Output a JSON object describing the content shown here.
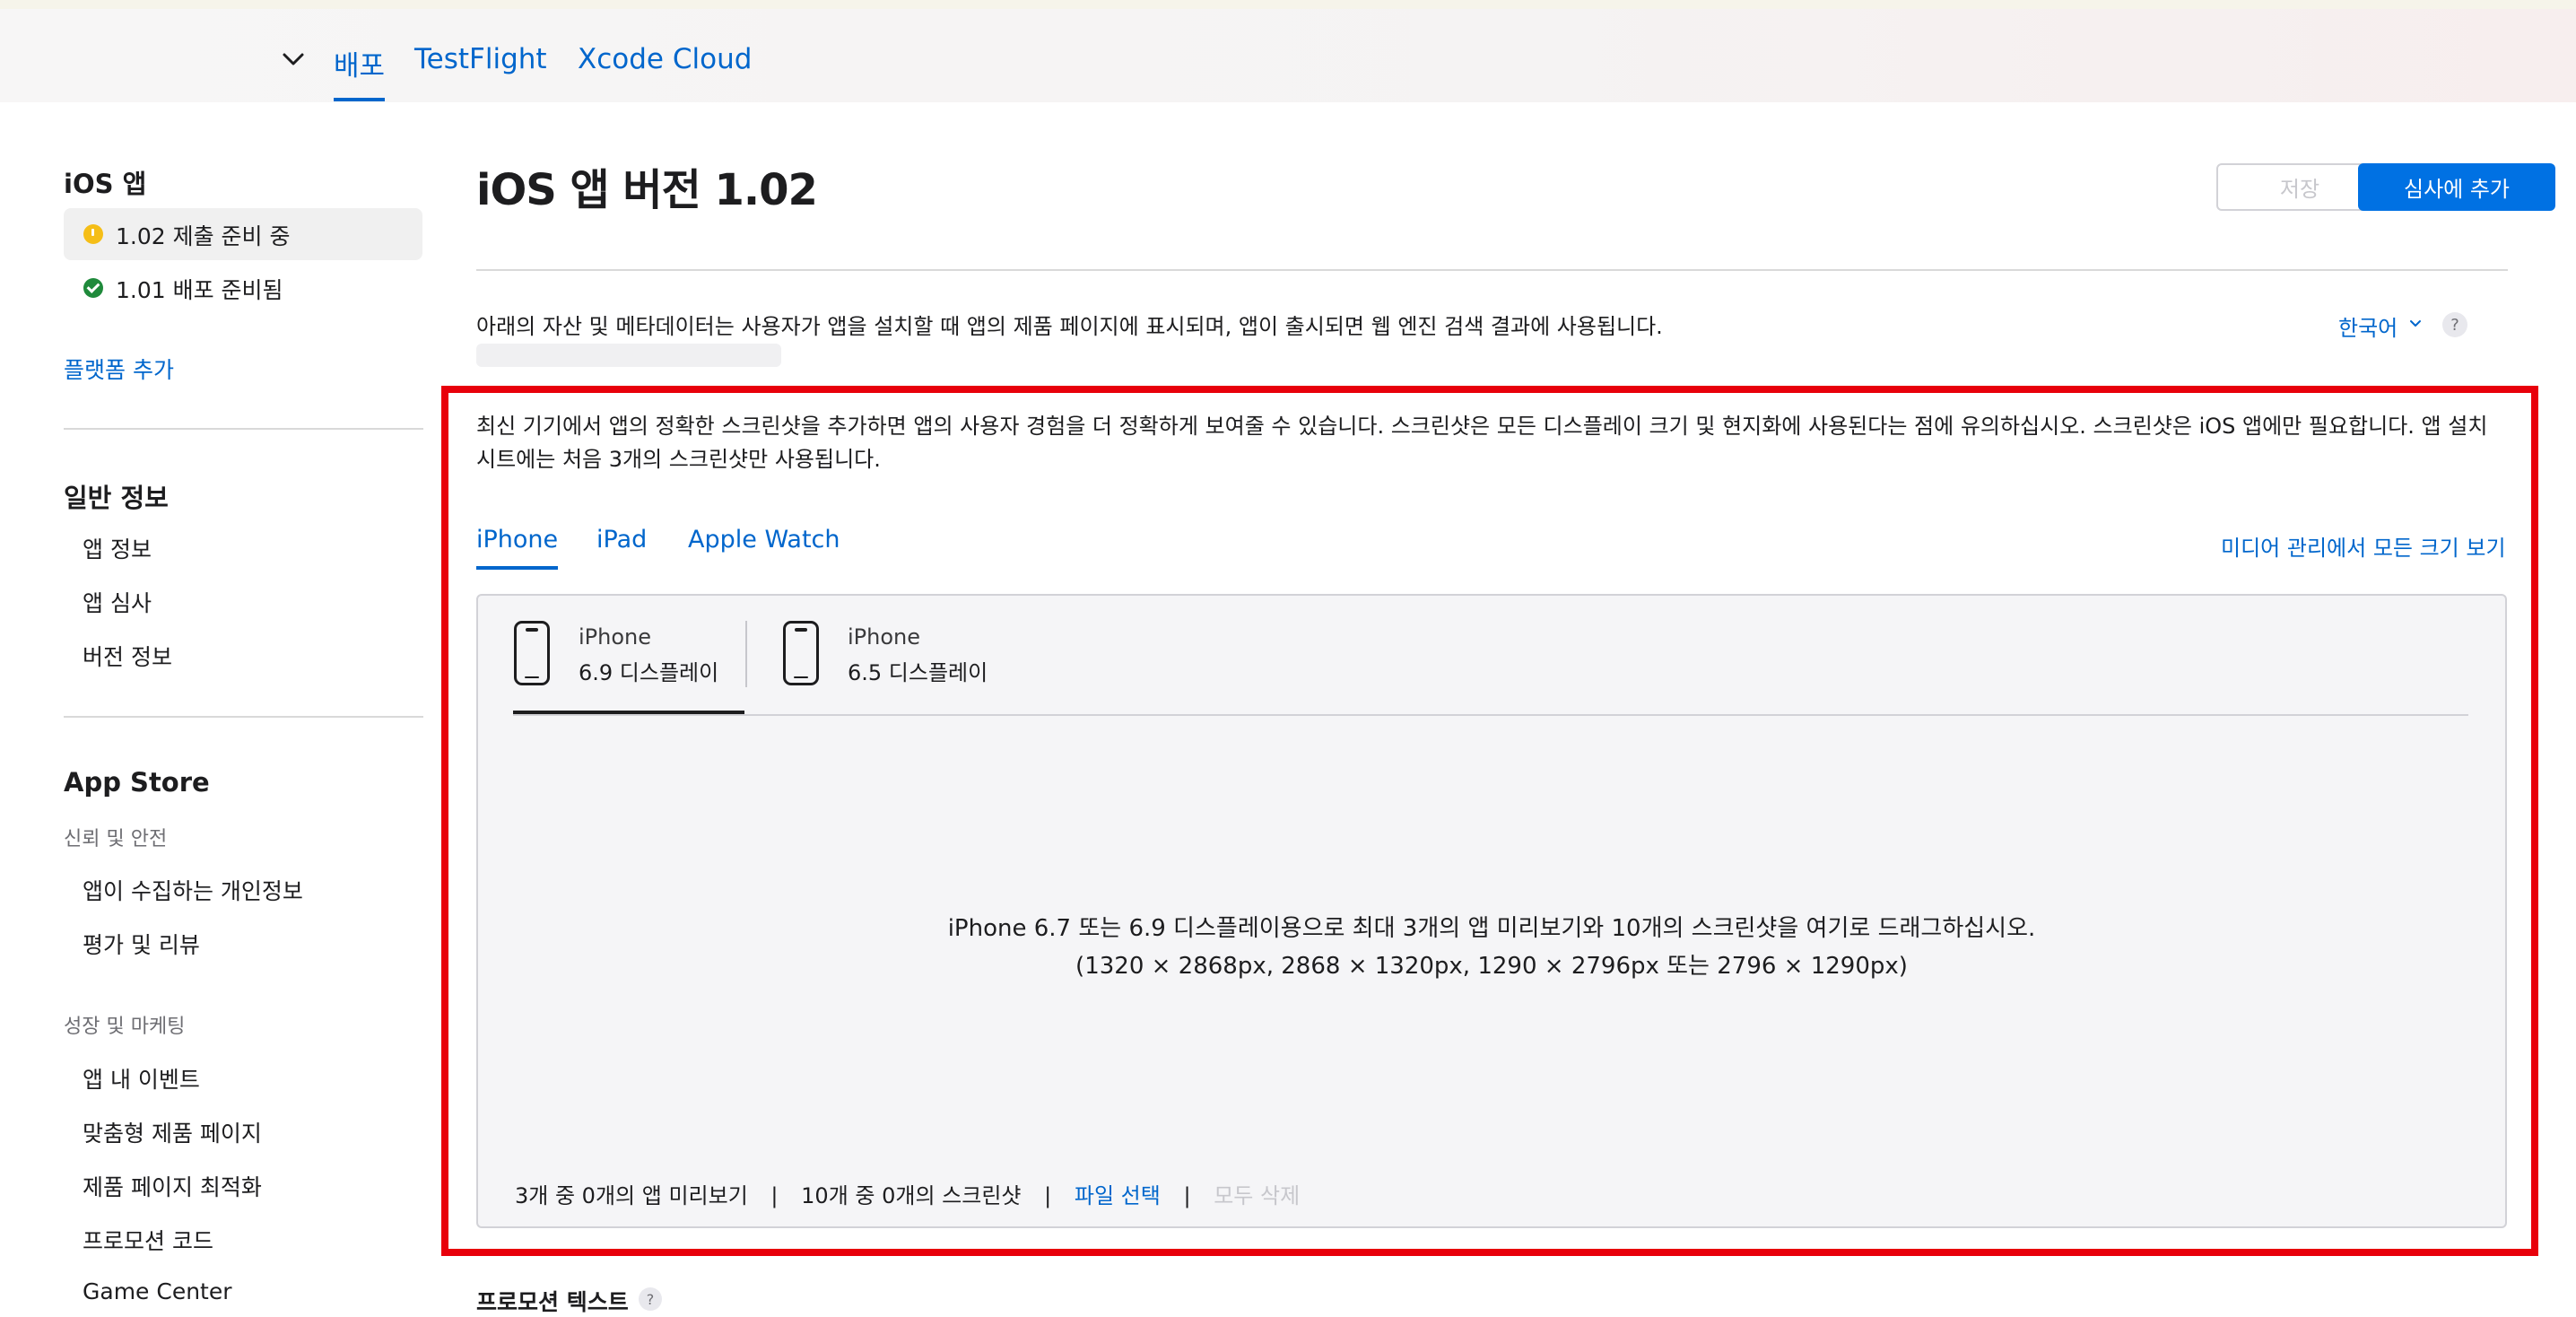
{
  "nav": {
    "tabs": [
      "배포",
      "TestFlight",
      "Xcode Cloud"
    ]
  },
  "sidebar": {
    "ios_heading": "iOS 앱",
    "versions": [
      {
        "label": "1.02 제출 준비 중",
        "status": "yellow"
      },
      {
        "label": "1.01 배포 준비됨",
        "status": "green"
      }
    ],
    "add_platform": "플랫폼 추가",
    "general_heading": "일반 정보",
    "general_items": [
      "앱 정보",
      "앱 심사",
      "버전 정보"
    ],
    "appstore_heading": "App Store",
    "trust_heading": "신뢰 및 안전",
    "trust_items": [
      "앱이 수집하는 개인정보",
      "평가 및 리뷰"
    ],
    "growth_heading": "성장 및 마케팅",
    "growth_items": [
      "앱 내 이벤트",
      "맞춤형 제품 페이지",
      "제품 페이지 최적화",
      "프로모션 코드",
      "Game Center"
    ]
  },
  "main": {
    "title": "iOS 앱 버전 1.02",
    "save_label": "저장",
    "submit_label": "심사에 추가",
    "intro": "아래의 자산 및 메타데이터는 사용자가 앱을 설치할 때 앱의 제품 페이지에 표시되며, 앱이 출시되면 웹 엔진 검색 결과에 사용됩니다.",
    "language": "한국어",
    "help": "?",
    "screenshot_desc": "최신 기기에서 앱의 정확한 스크린샷을 추가하면 앱의 사용자 경험을 더 정확하게 보여줄 수 있습니다. 스크린샷은 모든 디스플레이 크기 및 현지화에 사용된다는 점에 유의하십시오. 스크린샷은 iOS 앱에만 필요합니다. 앱 설치 시트에는 처음 3개의 스크린샷만 사용됩니다.",
    "device_tabs": [
      "iPhone",
      "iPad",
      "Apple Watch"
    ],
    "media_link": "미디어 관리에서 모든 크기 보기",
    "devices": [
      {
        "name": "iPhone",
        "size": "6.9 디스플레이"
      },
      {
        "name": "iPhone",
        "size": "6.5 디스플레이"
      }
    ],
    "drop_line1": "iPhone 6.7 또는 6.9 디스플레이용으로 최대 3개의 앱 미리보기와 10개의 스크린샷을 여기로 드래그하십시오.",
    "drop_line2": "(1320 × 2868px, 2868 × 1320px, 1290 × 2796px 또는 2796 × 1290px)",
    "footer": {
      "previews": "3개 중 0개의 앱 미리보기",
      "screenshots": "10개 중 0개의 스크린샷",
      "choose_file": "파일 선택",
      "delete_all": "모두 삭제",
      "separator": "|"
    },
    "promo_heading": "프로모션 텍스트"
  },
  "colors": {
    "accent": "#0066cc",
    "primary_button": "#0071e3",
    "highlight_box": "#e8000b",
    "status_pending": "#f5be17",
    "status_ready": "#1f8a3b"
  }
}
